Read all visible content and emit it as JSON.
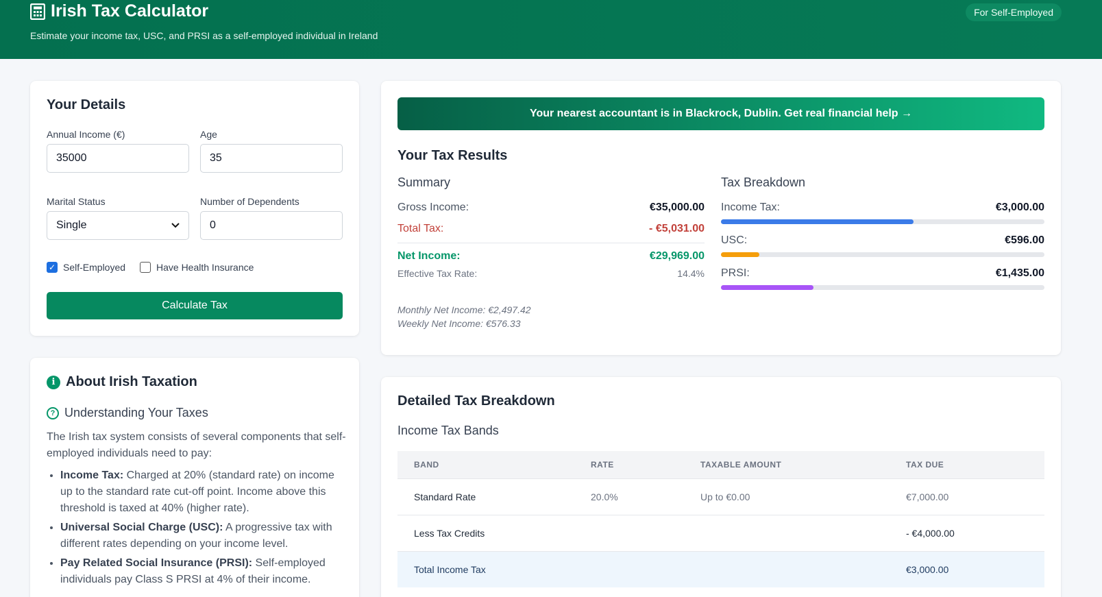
{
  "header": {
    "title": "Irish Tax Calculator",
    "subtitle": "Estimate your income tax, USC, and PRSI as a self-employed individual in Ireland",
    "badge": "For Self-Employed",
    "icon": "calculator-icon"
  },
  "details": {
    "title": "Your Details",
    "income_label": "Annual Income (€)",
    "income_value": "35000",
    "age_label": "Age",
    "age_value": "35",
    "marital_label": "Marital Status",
    "marital_value": "Single",
    "dependents_label": "Number of Dependents",
    "dependents_value": "0",
    "self_employed_label": "Self-Employed",
    "self_employed_checked": true,
    "health_label": "Have Health Insurance",
    "health_checked": false,
    "calc_button": "Calculate Tax"
  },
  "about": {
    "title": "About Irish Taxation",
    "subtitle": "Understanding Your Taxes",
    "intro": "The Irish tax system consists of several components that self-employed individuals need to pay:",
    "items": [
      {
        "term": "Income Tax:",
        "text": " Charged at 20% (standard rate) on income up to the standard rate cut-off point. Income above this threshold is taxed at 40% (higher rate)."
      },
      {
        "term": "Universal Social Charge (USC):",
        "text": " A progressive tax with different rates depending on your income level."
      },
      {
        "term": "Pay Related Social Insurance (PRSI):",
        "text": " Self-employed individuals pay Class S PRSI at 4% of their income."
      }
    ]
  },
  "results": {
    "banner": "Your nearest accountant is in Blackrock, Dublin. Get real financial help →",
    "title": "Your Tax Results",
    "summary_title": "Summary",
    "gross_label": "Gross Income:",
    "gross_value": "€35,000.00",
    "total_tax_label": "Total Tax:",
    "total_tax_value": "- €5,031.00",
    "net_label": "Net Income:",
    "net_value": "€29,969.00",
    "rate_label": "Effective Tax Rate:",
    "rate_value": "14.4%",
    "monthly": "Monthly Net Income: €2,497.42",
    "weekly": "Weekly Net Income: €576.33",
    "breakdown_title": "Tax Breakdown",
    "breakdown": [
      {
        "label": "Income Tax:",
        "value": "€3,000.00",
        "fraction": 0.596,
        "color": "#3b7be8"
      },
      {
        "label": "USC:",
        "value": "€596.00",
        "fraction": 0.118,
        "color": "#f59e0b"
      },
      {
        "label": "PRSI:",
        "value": "€1,435.00",
        "fraction": 0.285,
        "color": "#a855f7"
      }
    ]
  },
  "detailed": {
    "title": "Detailed Tax Breakdown",
    "subtitle": "Income Tax Bands",
    "columns": [
      "BAND",
      "RATE",
      "TAXABLE AMOUNT",
      "TAX DUE"
    ],
    "rows": [
      [
        "Standard Rate",
        "20.0%",
        "Up to €0.00",
        "€7,000.00"
      ],
      [
        "Less Tax Credits",
        "",
        "",
        "- €4,000.00"
      ],
      [
        "Total Income Tax",
        "",
        "",
        "€3,000.00"
      ]
    ]
  }
}
